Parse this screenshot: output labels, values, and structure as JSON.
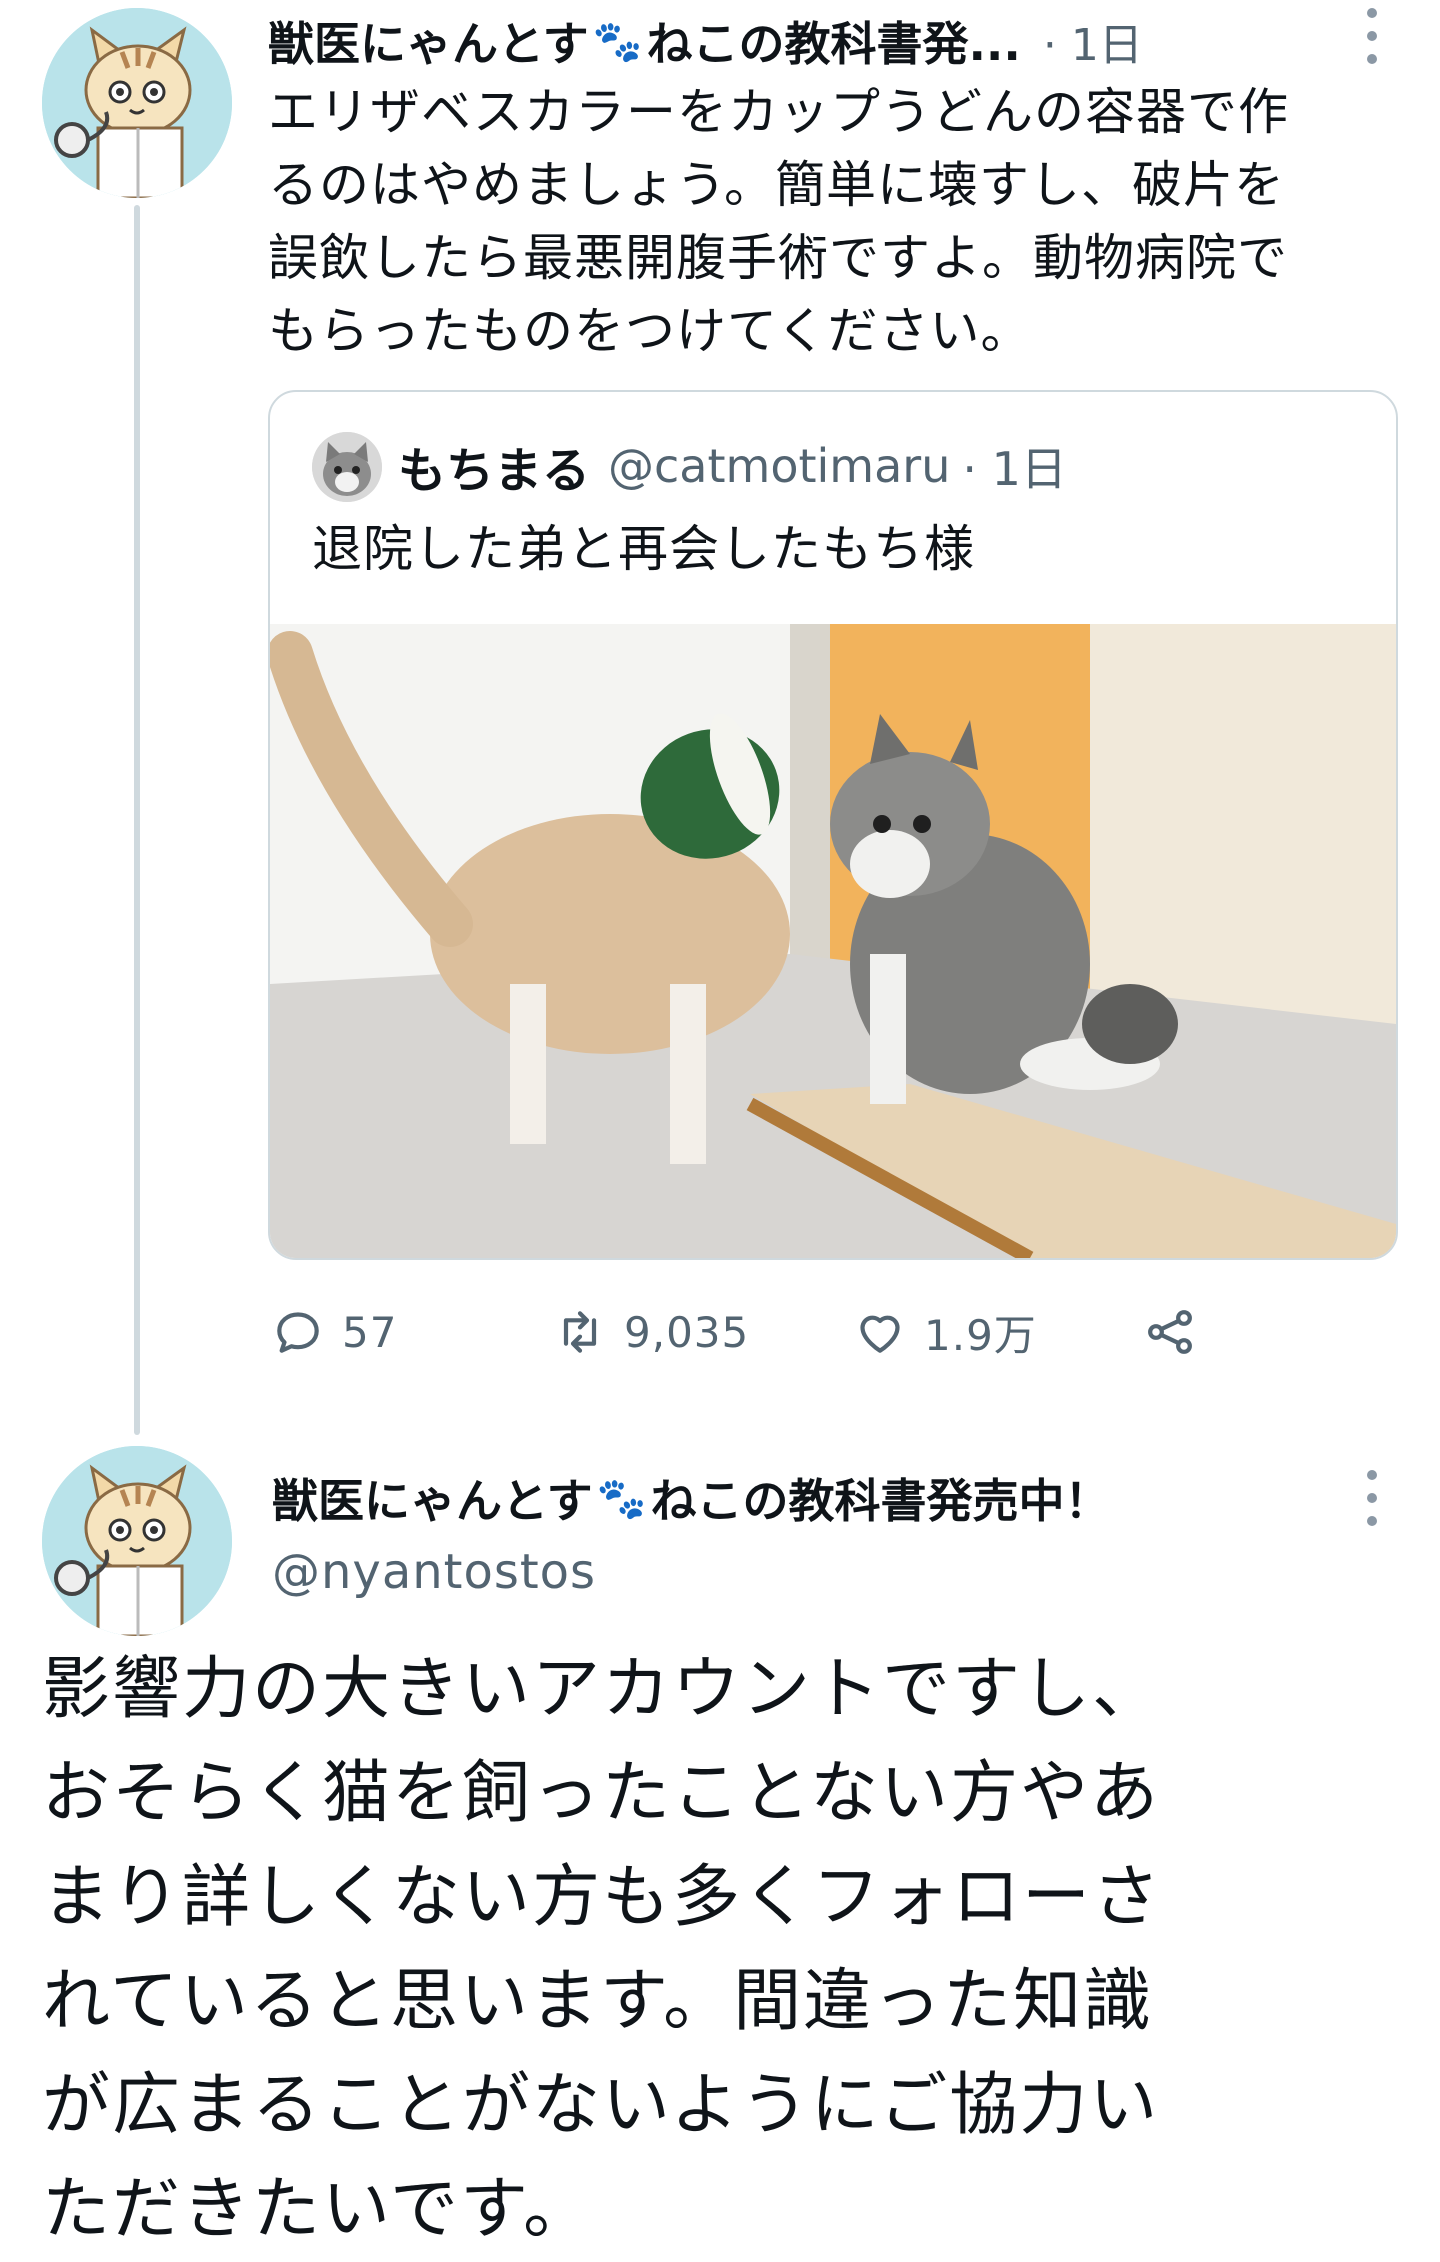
{
  "tweet1": {
    "author_name": "獣医にゃんとす",
    "author_name_suffix": "ねこの教科書発...",
    "paw_emoji": "🐾",
    "time": "· 1日",
    "text": "エリザベスカラーをカップうどんの容器で作\nるのはやめましょう。簡単に壊すし、破片を\n誤飲したら最悪開腹手術ですよ。動物病院で\nもらったものをつけてください。",
    "quote": {
      "author_name": "もちまる",
      "handle": "@catmotimaru",
      "time": "· 1日",
      "text": "退院した弟と再会したもち様"
    },
    "actions": {
      "replies": "57",
      "retweets": "9,035",
      "likes": "1.9万"
    }
  },
  "tweet2": {
    "author_name": "獣医にゃんとす",
    "author_name_suffix": "ねこの教科書発売中！",
    "paw_emoji": "🐾",
    "handle": "@nyantostos",
    "text": "影響力の大きいアカウントですし、\nおそらく猫を飼ったことない方やあ\nまり詳しくない方も多くフォローさ\nれていると思います。間違った知識\nが広まることがないようにご協力い\nただきたいです。"
  },
  "colors": {
    "text_primary": "#0f1419",
    "text_secondary": "#536471",
    "border": "#cfd9de",
    "avatar_bg": "#b9e3ea"
  },
  "icons": {
    "reply": "reply-icon",
    "retweet": "retweet-icon",
    "like": "heart-icon",
    "share": "share-icon",
    "more": "more-vertical-icon"
  }
}
